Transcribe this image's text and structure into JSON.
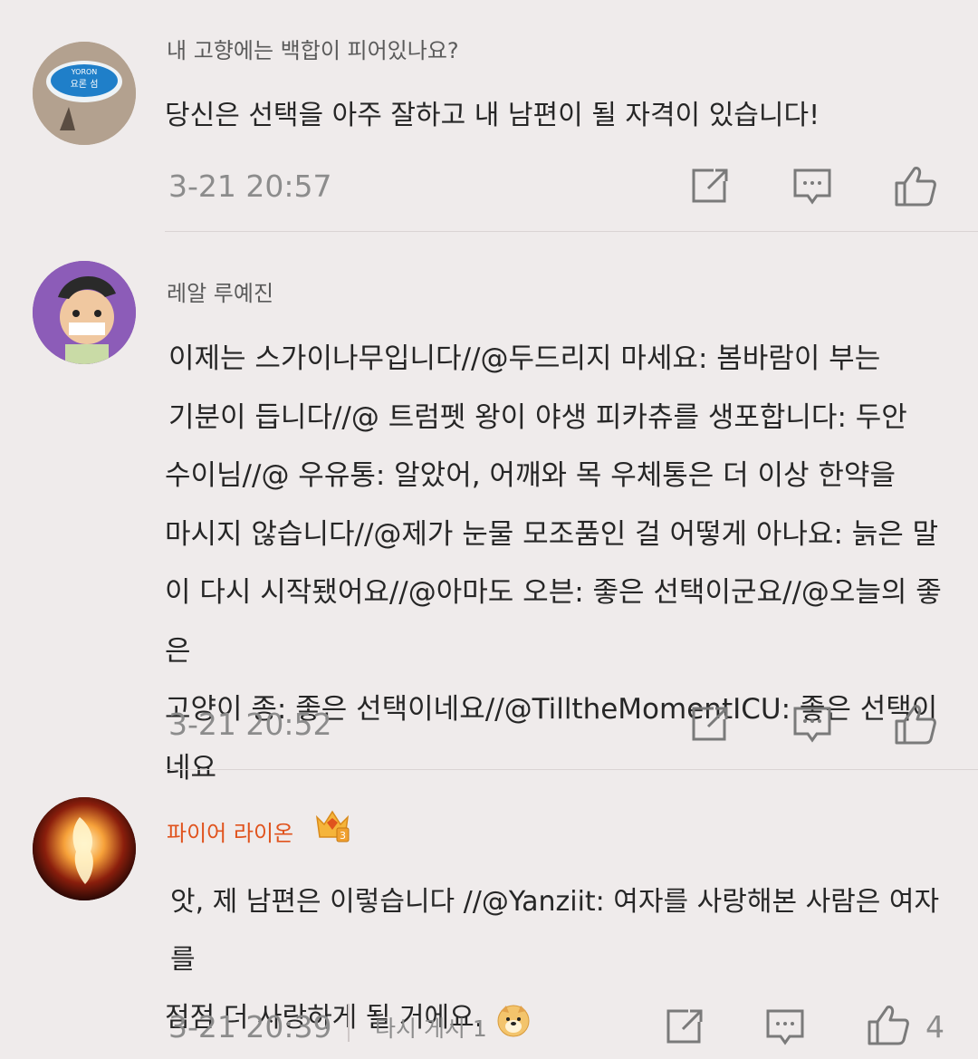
{
  "comments": [
    {
      "author": "내 고향에는 백합이 피어있나요?",
      "avatar_text": "YORON 요론 섬 百合ヶ浜",
      "text_lines": [
        "당신은 선택을 아주 잘하고 내 남편이 될 자격이 있습니다!"
      ],
      "time": "3-21 20:57"
    },
    {
      "author": "레알 루예진",
      "text_lines": [
        "이제는 스가이나무입니다//@두드리지 마세요: 봄바람이 부는",
        "기분이 듭니다//@ 트럼펫 왕이 야생 피카츄를 생포합니다: 두안",
        "수이님//@ 우유통: 알았어, 어깨와 목 우체통은 더 이상 한약을",
        "마시지 않습니다//@제가 눈물 모조품인 걸 어떻게 아나요: 늙은 말",
        "이 다시 시작됐어요//@아마도 오븐: 좋은 선택이군요//@오늘의 좋은",
        "고양이 종: 좋은 선택이네요//@TilltheMomentICU: 좋은 선택이네요"
      ],
      "time": "3-21 20:52"
    },
    {
      "author": "파이어 라이온",
      "badge_level": "3",
      "text_lines": [
        "앗, 제 남편은 이렇습니다 //@Yanziit: 여자를 사랑해본 사람은 여자를",
        "점점 더 사랑하게 될 거에요."
      ],
      "time": "3-21 20:39",
      "repost_label": "다시 게시 1",
      "like_count": "4"
    }
  ],
  "icons": [
    "share-icon",
    "comment-icon",
    "like-icon"
  ],
  "colors": {
    "vip_name": "#e0531d",
    "meta": "#8c8c8c",
    "background": "#efebeb"
  }
}
